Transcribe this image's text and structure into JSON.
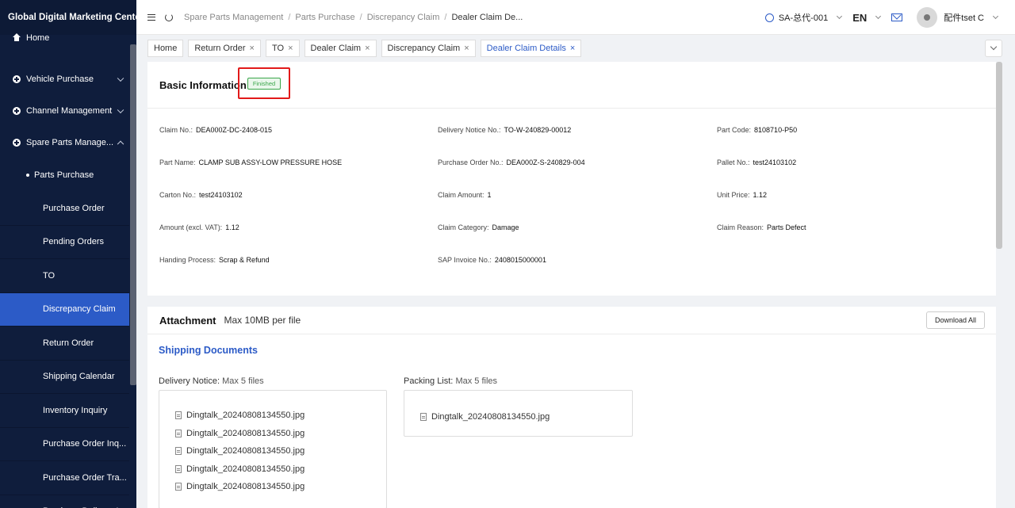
{
  "sidebar": {
    "brand": "Global Digital Marketing Center",
    "home": "Home",
    "groups": [
      {
        "label": "Vehicle Purchase"
      },
      {
        "label": "Channel Management"
      },
      {
        "label": "Spare Parts Manage..."
      }
    ],
    "sub_parent": "Parts Purchase",
    "items": [
      {
        "label": "Purchase Order"
      },
      {
        "label": "Pending Orders"
      },
      {
        "label": "TO"
      },
      {
        "label": "Discrepancy Claim"
      },
      {
        "label": "Return Order"
      },
      {
        "label": "Shipping Calendar"
      },
      {
        "label": "Inventory Inquiry"
      },
      {
        "label": "Purchase Order Inq..."
      },
      {
        "label": "Purchase Order Tra..."
      },
      {
        "label": "Purchase Delivery I..."
      }
    ]
  },
  "header": {
    "breadcrumbs": [
      "Spare Parts Management",
      "Parts Purchase",
      "Discrepancy Claim",
      "Dealer Claim De..."
    ],
    "account": "SA-总代-001",
    "language": "EN",
    "user_name": "配件tset C"
  },
  "tabs": [
    {
      "label": "Home",
      "closable": false
    },
    {
      "label": "Return Order",
      "closable": true
    },
    {
      "label": "TO",
      "closable": true
    },
    {
      "label": "Dealer Claim",
      "closable": true
    },
    {
      "label": "Discrepancy Claim",
      "closable": true
    },
    {
      "label": "Dealer Claim Details",
      "closable": true
    }
  ],
  "tab_close_glyph": "×",
  "basic": {
    "title": "Basic Information",
    "status": "Finished",
    "fields": [
      {
        "label": "Claim No.:",
        "value": "DEA000Z-DC-2408-015"
      },
      {
        "label": "Delivery Notice No.:",
        "value": "TO-W-240829-00012"
      },
      {
        "label": "Part Code:",
        "value": "8108710-P50"
      },
      {
        "label": "Part Name:",
        "value": "CLAMP SUB ASSY-LOW PRESSURE HOSE"
      },
      {
        "label": "Purchase Order No.:",
        "value": "DEA000Z-S-240829-004"
      },
      {
        "label": "Pallet No.:",
        "value": "test24103102"
      },
      {
        "label": "Carton No.:",
        "value": "test24103102"
      },
      {
        "label": "Claim Amount:",
        "value": "1"
      },
      {
        "label": "Unit Price:",
        "value": "1.12"
      },
      {
        "label": "Amount (excl. VAT):",
        "value": "1.12"
      },
      {
        "label": "Claim Category:",
        "value": "Damage"
      },
      {
        "label": "Claim Reason:",
        "value": "Parts Defect"
      },
      {
        "label": "Handing Process:",
        "value": "Scrap & Refund"
      },
      {
        "label": "SAP Invoice No.:",
        "value": "2408015000001"
      }
    ]
  },
  "attachment": {
    "title": "Attachment",
    "subtitle": "Max 10MB per file",
    "download_all": "Download All",
    "shipping_title": "Shipping Documents",
    "delivery_notice": {
      "label": "Delivery Notice:",
      "limit": "Max 5 files",
      "files": [
        "Dingtalk_20240808134550.jpg",
        "Dingtalk_20240808134550.jpg",
        "Dingtalk_20240808134550.jpg",
        "Dingtalk_20240808134550.jpg",
        "Dingtalk_20240808134550.jpg"
      ]
    },
    "packing_list": {
      "label": "Packing List:",
      "limit": "Max 5 files",
      "files": [
        "Dingtalk_20240808134550.jpg"
      ]
    }
  },
  "colors": {
    "sidebar_bg": "#0f1d3c",
    "active_item": "#2c5bc7",
    "status_green": "#3aa64a",
    "highlight_red": "#e21a1a"
  }
}
